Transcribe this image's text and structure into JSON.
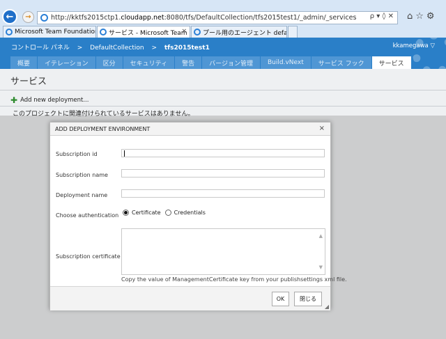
{
  "browser": {
    "url_prefix": "http://kktfs2015ctp1.",
    "url_host": "cloudapp.net",
    "url_suffix": ":8080/tfs/DefaultCollection/tfs2015test1/_admin/_services",
    "addr_tools": "ρ ▾ ◊ ✕",
    "tabs": [
      {
        "label": "Microsoft Team Foundation..."
      },
      {
        "label": "サービス - Microsoft Team ..."
      },
      {
        "label": "プール用のエージェント default -..."
      }
    ],
    "tab_close": "×"
  },
  "header": {
    "breadcrumb": [
      "コントロール パネル",
      ">",
      "DefaultCollection",
      ">",
      "tfs2015test1"
    ],
    "user": "kkamegawa ▽",
    "tabs": [
      "概要",
      "イテレーション",
      "区分",
      "セキュリティ",
      "警告",
      "バージョン管理",
      "Build.vNext",
      "サービス フック",
      "サービス"
    ]
  },
  "page": {
    "title": "サービス",
    "add_label": "Add new deployment...",
    "empty_message": "このプロジェクトに関連付けられているサービスはありません。"
  },
  "dialog": {
    "title": "ADD DEPLOYMENT ENVIRONMENT",
    "close": "×",
    "labels": {
      "subscription_id": "Subscription id",
      "subscription_name": "Subscription name",
      "deployment_name": "Deployment name",
      "auth": "Choose authentication",
      "certificate": "Subscription certificate"
    },
    "auth_options": [
      "Certificate",
      "Credentials"
    ],
    "selected_auth": "Certificate",
    "hint": "Copy the value of ManagementCertificate key from your publishsettings xml file.",
    "ok": "OK",
    "close_button": "閉じる"
  },
  "colors": {
    "header_blue": "#2a7fc8",
    "tab_blue": "#4f96d4",
    "add_green": "#2e8b2e"
  }
}
